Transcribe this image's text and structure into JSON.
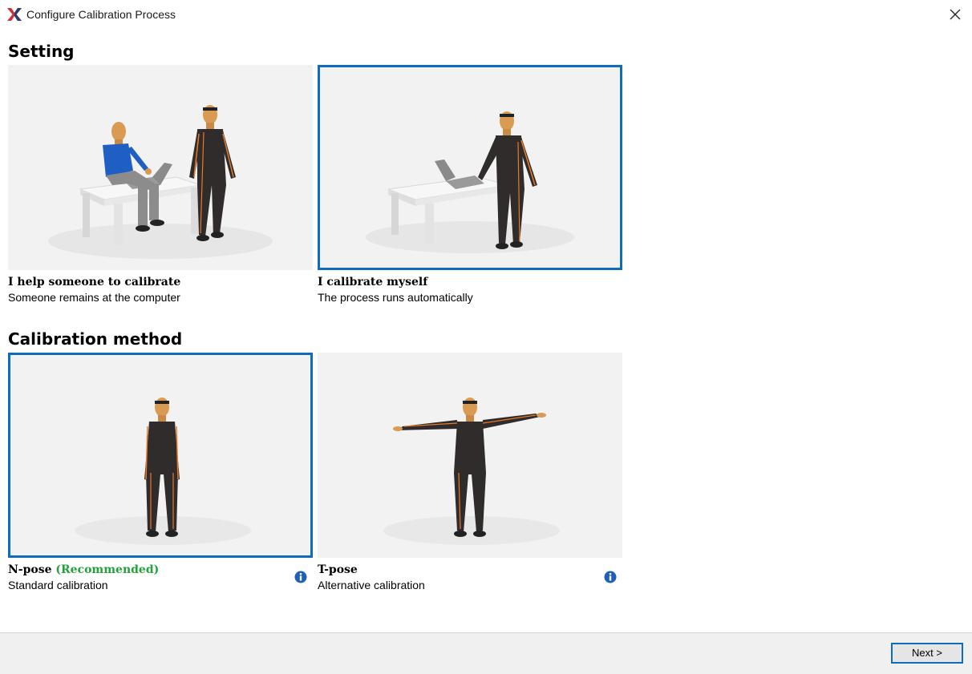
{
  "window": {
    "title": "Configure Calibration Process"
  },
  "setting": {
    "heading": "Setting",
    "options": [
      {
        "title": "I help someone to calibrate",
        "subtitle": "Someone remains at the computer",
        "selected": false
      },
      {
        "title": "I calibrate myself",
        "subtitle": "The process runs automatically",
        "selected": true
      }
    ]
  },
  "method": {
    "heading": "Calibration method",
    "options": [
      {
        "title": "N-pose",
        "badge": "(Recommended)",
        "subtitle": "Standard calibration",
        "selected": true,
        "info_icon": "info-icon"
      },
      {
        "title": "T-pose",
        "subtitle": "Alternative calibration",
        "selected": false,
        "info_icon": "info-icon"
      }
    ]
  },
  "footer": {
    "next_label": "Next >"
  },
  "colors": {
    "accent": "#0f6cbd",
    "recommended": "#23a03a",
    "suit": "#2f2c2b",
    "suit_stripe": "#e87a2a",
    "skin": "#d99a52"
  }
}
